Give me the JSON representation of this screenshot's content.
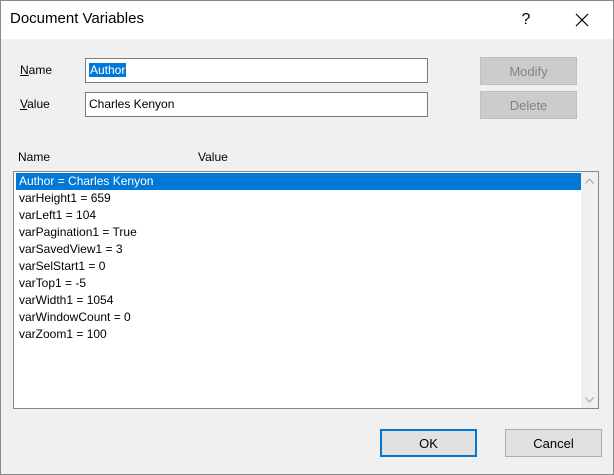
{
  "window": {
    "title": "Document Variables",
    "help_label": "?"
  },
  "form": {
    "name_label": "ame",
    "name_accel": "N",
    "name_value": "Author",
    "value_label": "alue",
    "value_accel": "V",
    "value_value": "Charles Kenyon"
  },
  "buttons": {
    "modify": "Modify",
    "delete": "Delete",
    "ok": "OK",
    "cancel": "Cancel"
  },
  "list": {
    "col_name": "Name",
    "col_value": "Value",
    "items": [
      "Author = Charles Kenyon",
      "varHeight1 = 659",
      "varLeft1 = 104",
      "varPagination1 = True",
      "varSavedView1 = 3",
      "varSelStart1 = 0",
      "varTop1 = -5",
      "varWidth1 = 1054",
      "varWindowCount = 0",
      "varZoom1 = 100"
    ],
    "selected_index": 0
  },
  "colors": {
    "accent": "#0078d7",
    "dialog_bg": "#f0f0f0",
    "disabled_text": "#838383"
  }
}
